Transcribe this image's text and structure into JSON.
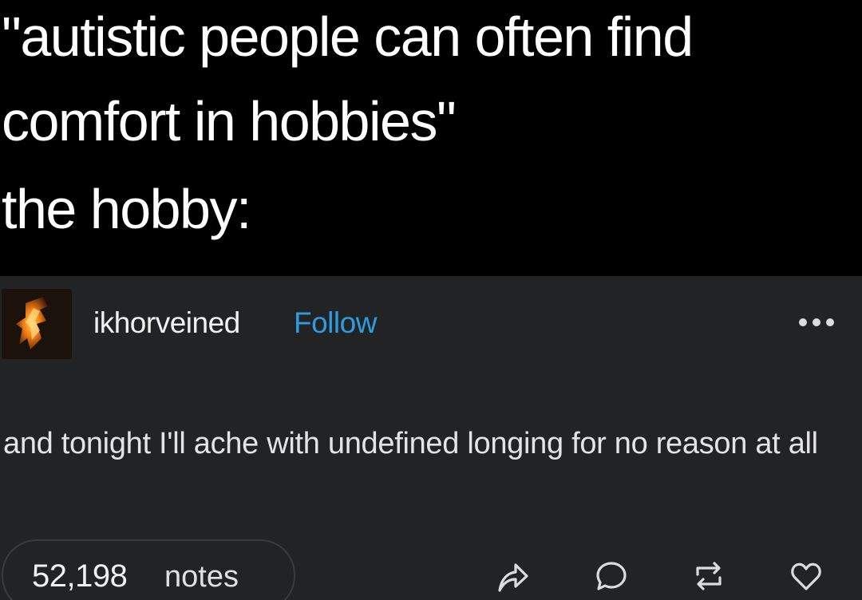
{
  "caption": {
    "line1": "\"autistic people can often find",
    "line2": "comfort in hobbies\"",
    "line3": "the hobby:"
  },
  "post": {
    "username": "ikhorveined",
    "follow_label": "Follow",
    "more_icon": "more-icon",
    "body": "and tonight I'll ache with undefined longing for no reason at all",
    "notes_count": "52,198",
    "notes_label": "notes",
    "actions": [
      "share-icon",
      "reply-icon",
      "reblog-icon",
      "like-icon"
    ]
  },
  "colors": {
    "caption_bg": "#000000",
    "post_bg": "#222325",
    "follow": "#2f9ce0",
    "text": "#e4e4e4"
  }
}
